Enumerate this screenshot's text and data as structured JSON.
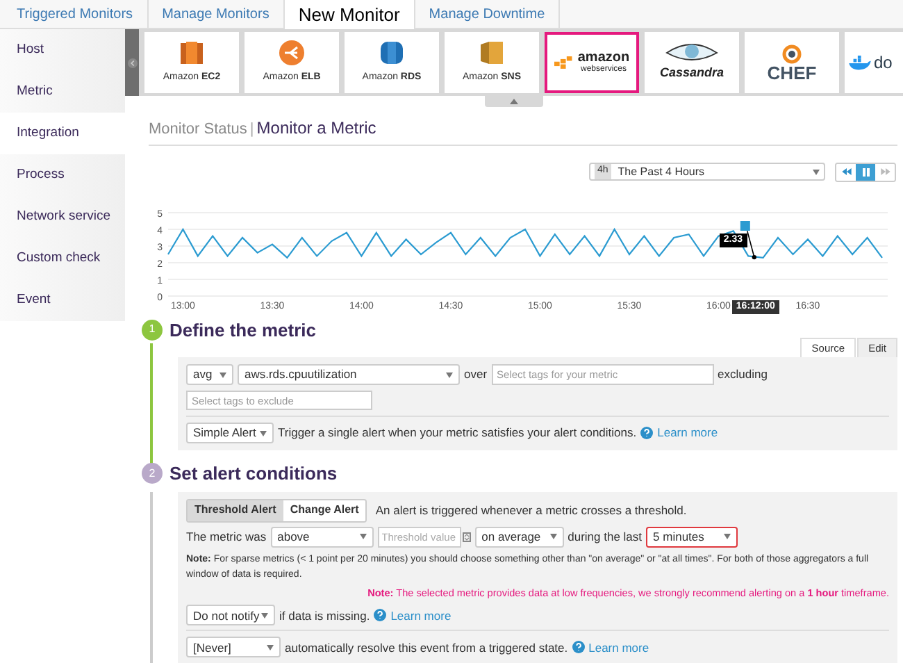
{
  "top_tabs": [
    {
      "label": "Triggered Monitors",
      "selected": false
    },
    {
      "label": "Manage Monitors",
      "selected": false
    },
    {
      "label": "New Monitor",
      "selected": true
    },
    {
      "label": "Manage Downtime",
      "selected": false
    }
  ],
  "sidebar": {
    "items": [
      {
        "label": "Host",
        "selected": false
      },
      {
        "label": "Metric",
        "selected": false
      },
      {
        "label": "Integration",
        "selected": true
      },
      {
        "label": "Process",
        "selected": false
      },
      {
        "label": "Network service",
        "selected": false
      },
      {
        "label": "Custom check",
        "selected": false
      },
      {
        "label": "Event",
        "selected": false
      }
    ]
  },
  "integrations": [
    {
      "kind": "ec2",
      "label": "Amazon **EC2**",
      "selected": false
    },
    {
      "kind": "elb",
      "label": "Amazon **ELB**",
      "selected": false
    },
    {
      "kind": "rds",
      "label": "Amazon **RDS**",
      "selected": false
    },
    {
      "kind": "sns",
      "label": "Amazon **SNS**",
      "selected": false
    },
    {
      "kind": "aws",
      "label": "amazon",
      "sublabel": "webservices",
      "selected": true
    },
    {
      "kind": "cassandra",
      "label": "Cassandra",
      "selected": false
    },
    {
      "kind": "chef",
      "label": "CHEF",
      "selected": false
    },
    {
      "kind": "docker",
      "label": "do",
      "selected": false
    }
  ],
  "breadcrumb": {
    "parent": "Monitor Status",
    "separator": "|",
    "current": "Monitor a Metric"
  },
  "time_range": {
    "badge": "4h",
    "value": "The Past 4 Hours"
  },
  "playback": [
    {
      "kind": "back",
      "selected": false
    },
    {
      "kind": "pause",
      "selected": true
    },
    {
      "kind": "forward",
      "selected": false
    }
  ],
  "chart": {
    "hover_value": "2.33",
    "hover_time": "16:12:00",
    "chart_data": {
      "type": "line",
      "categories": [
        null,
        "13:00",
        null,
        null,
        null,
        null,
        null,
        "13:30",
        null,
        null,
        null,
        null,
        null,
        "14:00",
        null,
        null,
        null,
        null,
        null,
        "14:30",
        null,
        null,
        null,
        null,
        null,
        "15:00",
        null,
        null,
        null,
        null,
        null,
        "15:30",
        null,
        null,
        null,
        null,
        null,
        "16:00",
        null,
        null,
        null,
        null,
        null,
        "16:30",
        null,
        null,
        null,
        null,
        null
      ],
      "series": [
        {
          "color": "#2b9bd1",
          "values": [
            2.5,
            4.0,
            2.4,
            3.6,
            2.4,
            3.5,
            2.6,
            3.1,
            2.3,
            3.5,
            2.4,
            3.3,
            3.8,
            2.4,
            3.8,
            2.4,
            3.4,
            2.5,
            3.2,
            3.8,
            2.5,
            3.5,
            2.4,
            3.5,
            4.0,
            2.4,
            3.7,
            2.5,
            3.6,
            2.4,
            4.0,
            2.5,
            3.6,
            2.4,
            3.5,
            3.7,
            2.4,
            3.6,
            3.9,
            2.4,
            2.3,
            3.5,
            2.5,
            3.4,
            2.4,
            3.6,
            2.5,
            3.5,
            2.3
          ]
        }
      ],
      "ylim": [
        0,
        5
      ],
      "yticks": [
        0,
        1,
        2,
        3,
        4,
        5
      ],
      "grid": true
    }
  },
  "step1": {
    "number": "1",
    "title": "Define the metric",
    "tabs": [
      {
        "label": "Source",
        "selected": true
      },
      {
        "label": "Edit",
        "selected": false
      }
    ],
    "aggregator": "avg",
    "metric": "aws.rds.cpuutilization",
    "over_label": "over",
    "over_placeholder": "Select tags for your metric",
    "excluding_label": "excluding",
    "exclude_placeholder": "Select tags to exclude",
    "alert_type": "Simple Alert",
    "alert_description": "Trigger a single alert when your metric satisfies your alert conditions.",
    "learn_more": "Learn more"
  },
  "step2": {
    "number": "2",
    "title": "Set alert conditions",
    "alert_tabs": [
      {
        "label": "Threshold Alert",
        "selected": true
      },
      {
        "label": "Change Alert",
        "selected": false
      }
    ],
    "alert_tabs_description": "An alert is triggered whenever a metric crosses a threshold.",
    "metric_was_label": "The metric was",
    "comparison": "above",
    "threshold_placeholder": "Threshold value",
    "aggregation": "on average",
    "during_label": "during the last",
    "window": "5 minutes",
    "note": "**Note:** For sparse metrics (< 1 point per 20 minutes) you should choose something other than \"on average\" or \"at all times\". For both of those aggregators a full window of data is required.",
    "warning": "**Note:** The selected metric provides data at low frequencies, we strongly recommend alerting on a **1 hour** timeframe.",
    "missing_option": "Do not notify",
    "missing_text": "if data is missing.",
    "missing_learn_more": "Learn more",
    "resolve_option": "[Never]",
    "resolve_text": "automatically resolve this event from a triggered state.",
    "resolve_learn_more": "Learn more"
  }
}
